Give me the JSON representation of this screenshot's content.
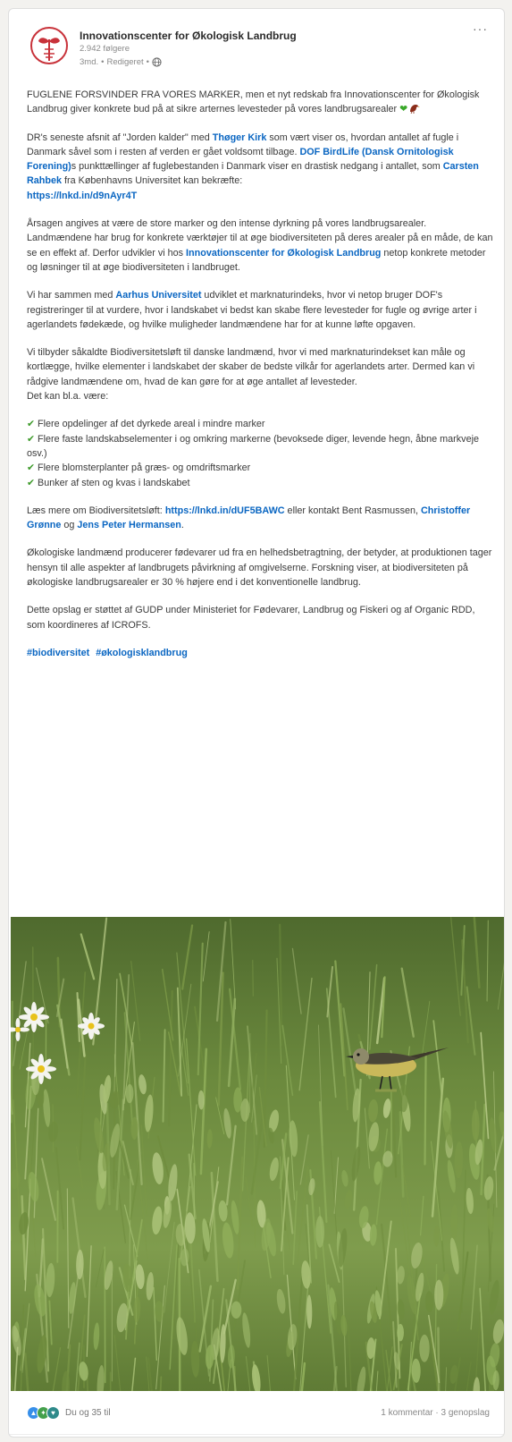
{
  "post": {
    "author": "Innovationscenter for Økologisk Landbrug",
    "followers": "2.942 følgere",
    "time": "3md.",
    "edited": "Redigeret",
    "more_label": "···",
    "p1": {
      "text": "FUGLENE FORSVINDER FRA VORES MARKER, men et nyt redskab fra Innovationscenter for Økologisk Landbrug giver konkrete bud på at sikre arternes levesteder på vores landbrugsarealer "
    },
    "p2": {
      "t1": "DR's seneste afsnit af \"Jorden kalder\" med ",
      "l1": "Thøger Kirk",
      "t2": " som vært viser os, hvordan antallet af fugle i Danmark såvel som i resten af verden er gået voldsomt tilbage. ",
      "l2": "DOF BirdLife (Dansk Ornitologisk Forening)",
      "t3": "s punkttællinger af fuglebestanden i Danmark viser en drastisk nedgang i antallet, som ",
      "l3": "Carsten Rahbek",
      "t4": " fra Københavns Universitet kan bekræfte:",
      "url": "https://lnkd.in/d9nAyr4T"
    },
    "p3": {
      "t1": "Årsagen angives at være de store marker og den intense dyrkning på vores landbrugsarealer. Landmændene har brug for konkrete værktøjer til at øge biodiversiteten på deres arealer på en måde, de kan se en effekt af. Derfor udvikler vi hos ",
      "l1": "Innovationscenter for Økologisk Landbrug",
      "t2": " netop konkrete metoder og løsninger til at øge biodiversiteten i landbruget."
    },
    "p4": {
      "t1": "Vi har sammen med ",
      "l1": "Aarhus Universitet",
      "t2": " udviklet et marknaturindeks, hvor vi netop bruger DOF's registreringer til at vurdere, hvor i landskabet vi bedst kan skabe flere levesteder for fugle og øvrige arter i agerlandets fødekæde, og hvilke muligheder landmændene har for at kunne løfte opgaven."
    },
    "p5": {
      "text": "Vi tilbyder såkaldte Biodiversitetsløft til danske landmænd, hvor vi med marknaturindekset kan måle og kortlægge, hvilke elementer i landskabet der skaber de bedste vilkår for agerlandets arter. Dermed kan vi rådgive landmændene om, hvad de kan gøre for at øge antallet af levesteder.",
      "text2": "Det kan bl.a. være:"
    },
    "checklist": [
      "Flere opdelinger af det dyrkede areal i mindre marker",
      "Flere faste landskabselementer i og omkring markerne (bevoksede diger, levende hegn, åbne markveje osv.)",
      "Flere blomsterplanter på græs- og omdriftsmarker",
      "Bunker af sten og kvas i landskabet"
    ],
    "p6": {
      "t1": "Læs mere om Biodiversitetsløft: ",
      "url": "https://lnkd.in/dUF5BAWC",
      "t2": " eller kontakt Bent Rasmussen, ",
      "l1": "Christoffer Grønne",
      "t3": " og ",
      "l2": "Jens Peter Hermansen",
      "t4": "."
    },
    "p7": {
      "text": "Økologiske landmænd producerer fødevarer ud fra en helhedsbetragtning, der betyder, at produktionen tager hensyn til alle aspekter af landbrugets påvirkning af omgivelserne. Forskning viser, at biodiversiteten på økologiske landbrugsarealer er 30 % højere end i det konventionelle landbrug."
    },
    "p8": {
      "text": "Dette opslag er støttet af GUDP under Ministeriet for Fødevarer, Landbrug og Fiskeri og af Organic RDD, som koordineres af ICROFS."
    },
    "hashtags": [
      "#biodiversitet",
      "#økologisklandbrug"
    ]
  },
  "footer": {
    "reactions_text": "Du og 35 til",
    "comments": "1 kommentar",
    "separator": " · ",
    "reposts": "3 genopslag"
  },
  "colors": {
    "link": "#0a66c2",
    "check": "#3d9a2a",
    "logo": "#c8323a"
  },
  "icons": {
    "logo": "plant-seedling-logo",
    "globe": "globe-icon",
    "heart": "green-heart-emoji",
    "bird": "bird-emoji",
    "check": "check-mark-icon"
  }
}
